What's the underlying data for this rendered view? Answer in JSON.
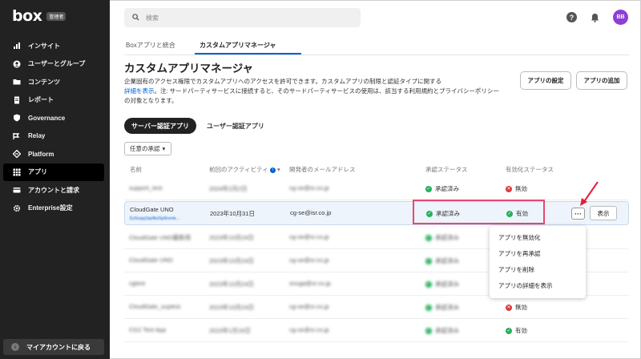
{
  "brand": {
    "logo": "box",
    "badge": "管理者"
  },
  "sidebar": {
    "items": [
      {
        "label": "インサイト",
        "icon": "bar-chart-icon"
      },
      {
        "label": "ユーザーとグループ",
        "icon": "users-icon"
      },
      {
        "label": "コンテンツ",
        "icon": "folder-icon"
      },
      {
        "label": "レポート",
        "icon": "report-icon"
      },
      {
        "label": "Governance",
        "icon": "shield-icon"
      },
      {
        "label": "Relay",
        "icon": "relay-icon"
      },
      {
        "label": "Platform",
        "icon": "platform-icon"
      },
      {
        "label": "アプリ",
        "icon": "apps-grid-icon",
        "active": true
      },
      {
        "label": "アカウントと請求",
        "icon": "card-icon"
      },
      {
        "label": "Enterprise設定",
        "icon": "gear-icon"
      }
    ],
    "back_label": "マイアカウントに戻る"
  },
  "search": {
    "placeholder": "検索"
  },
  "user": {
    "initials": "BB",
    "avatar_color": "#8d3fd6"
  },
  "tabs": {
    "t1": "Boxアプリと統合",
    "t2": "カスタムアプリマネージャ"
  },
  "page": {
    "title": "カスタムアプリマネージャ",
    "desc1": "企業固有のアクセス権限でカスタムアプリへのアクセスを許可できます。カスタムアプリの制限と認証タイプに関する",
    "desc_link": "詳細を表示",
    "desc2": "。注: サードパーティサービスに接続すると、そのサードパーティサービスの使用は、該当する利用規約とプライバシーポリシーの対象となります。",
    "settings_btn": "アプリの設定",
    "add_btn": "アプリの追加"
  },
  "filters": {
    "active_pill": "サーバー認証アプリ",
    "pill2": "ユーザー認証アプリ",
    "dropdown": "任意の承認"
  },
  "table": {
    "headers": {
      "name": "名前",
      "last": "前回のアクティビティ",
      "email": "開発者のメールアドレス",
      "approval": "承認ステータス",
      "enabled": "有効化ステータス"
    },
    "rows": [
      {
        "name": "support_test",
        "last": "2024年2月2日",
        "email": "cg-se@sr.co.jp",
        "approval": "承認済み",
        "enabled": "無効",
        "enabled_ok": false,
        "blur": true
      },
      {
        "name": "CloudGate UNO",
        "sub": "Ez5oqq1bp9kz5p9rxmk...",
        "last": "2023年10月31日",
        "email": "cg-se@isr.co.jp",
        "approval": "承認済み",
        "enabled": "有効",
        "enabled_ok": true,
        "blur": false
      },
      {
        "name": "CloudGate UNO最新用",
        "last": "2023年10月24日",
        "email": "cg-se@sr.co.jp",
        "approval": "承認済み",
        "enabled": "",
        "blur": true
      },
      {
        "name": "CloudGate UNO",
        "last": "2023年10月24日",
        "email": "cg-se@sr.co.jp",
        "approval": "承認済み",
        "enabled": "",
        "blur": true
      },
      {
        "name": "cgtest",
        "last": "2023年10月24日",
        "email": "snuga@sr.co.jp",
        "approval": "承認済み",
        "enabled": "",
        "blur": true
      },
      {
        "name": "CloudGate_suptest",
        "last": "2023年10月24日",
        "email": "cg-se@sr.co.jp",
        "approval": "承認済み",
        "enabled": "無効",
        "enabled_ok": false,
        "blur": true
      },
      {
        "name": "CG2 Test App",
        "last": "2023年1月16日",
        "email": "cg-se@sr.co.jp",
        "approval": "承認済み",
        "enabled": "有効",
        "enabled_ok": true,
        "blur": true
      }
    ],
    "show_btn": "表示",
    "more_btn": "···"
  },
  "menu": {
    "items": [
      "アプリを無効化",
      "アプリを再承認",
      "アプリを削除",
      "アプリの詳細を表示"
    ]
  },
  "colors": {
    "accent": "#0061d5",
    "highlight": "#e54a72",
    "ok": "#26b05c",
    "ng": "#d93a3a"
  }
}
